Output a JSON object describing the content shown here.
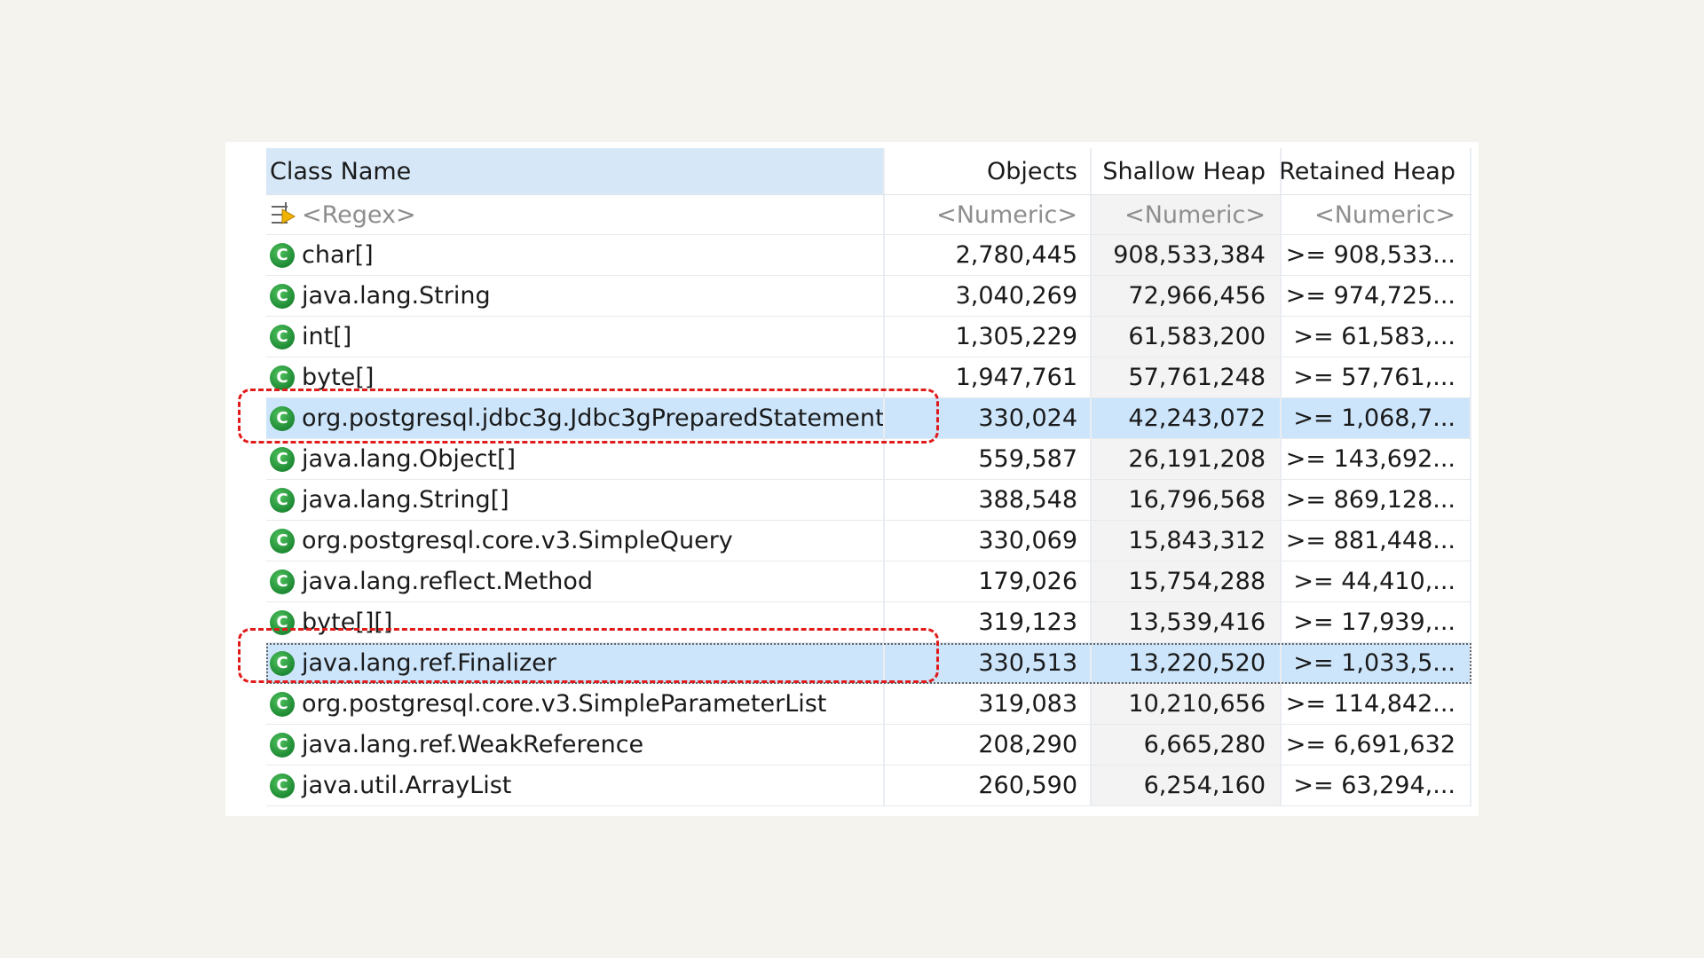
{
  "table": {
    "columns": {
      "class_name": "Class Name",
      "objects": "Objects",
      "shallow_heap": "Shallow Heap",
      "retained_heap": "Retained Heap"
    },
    "filters": {
      "class_name": "<Regex>",
      "objects": "<Numeric>",
      "shallow_heap": "<Numeric>",
      "retained_heap": "<Numeric>"
    },
    "rows": [
      {
        "name": "char[]",
        "objects": "2,780,445",
        "shallow": "908,533,384",
        "retained": ">= 908,533..."
      },
      {
        "name": "java.lang.String",
        "objects": "3,040,269",
        "shallow": "72,966,456",
        "retained": ">= 974,725..."
      },
      {
        "name": "int[]",
        "objects": "1,305,229",
        "shallow": "61,583,200",
        "retained": ">= 61,583,..."
      },
      {
        "name": "byte[]",
        "objects": "1,947,761",
        "shallow": "57,761,248",
        "retained": ">= 57,761,..."
      },
      {
        "name": "org.postgresql.jdbc3g.Jdbc3gPreparedStatement",
        "objects": "330,024",
        "shallow": "42,243,072",
        "retained": ">= 1,068,7..."
      },
      {
        "name": "java.lang.Object[]",
        "objects": "559,587",
        "shallow": "26,191,208",
        "retained": ">= 143,692..."
      },
      {
        "name": "java.lang.String[]",
        "objects": "388,548",
        "shallow": "16,796,568",
        "retained": ">= 869,128..."
      },
      {
        "name": "org.postgresql.core.v3.SimpleQuery",
        "objects": "330,069",
        "shallow": "15,843,312",
        "retained": ">= 881,448..."
      },
      {
        "name": "java.lang.reflect.Method",
        "objects": "179,026",
        "shallow": "15,754,288",
        "retained": ">= 44,410,..."
      },
      {
        "name": "byte[][]",
        "objects": "319,123",
        "shallow": "13,539,416",
        "retained": ">= 17,939,..."
      },
      {
        "name": "java.lang.ref.Finalizer",
        "objects": "330,513",
        "shallow": "13,220,520",
        "retained": ">= 1,033,5..."
      },
      {
        "name": "org.postgresql.core.v3.SimpleParameterList",
        "objects": "319,083",
        "shallow": "10,210,656",
        "retained": ">= 114,842..."
      },
      {
        "name": "java.lang.ref.WeakReference",
        "objects": "208,290",
        "shallow": "6,665,280",
        "retained": ">= 6,691,632"
      },
      {
        "name": "java.util.ArrayList",
        "objects": "260,590",
        "shallow": "6,254,160",
        "retained": ">= 63,294,..."
      }
    ],
    "class_icon_letter": "C",
    "icons": {
      "class": "class-c-icon",
      "filter": "regex-filter-icon"
    },
    "colors": {
      "selection": "#cde5fb",
      "header_sorted": "#d6e8f8",
      "annotation": "#e01b1b",
      "class_icon": "#2a9d3f"
    }
  }
}
